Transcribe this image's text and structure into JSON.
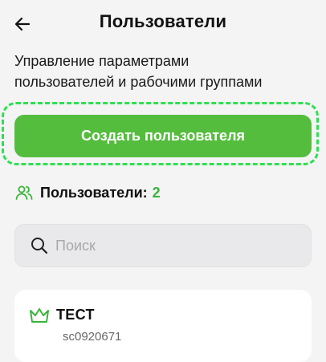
{
  "header": {
    "back_icon": "arrow-left-icon",
    "title": "Пользователи"
  },
  "description": {
    "line1": "Управление параметрами",
    "line2": "пользователей и рабочими группами"
  },
  "create_button": {
    "label": "Создать пользователя",
    "color": "#55bd3d",
    "highlight_color": "#2ee04f"
  },
  "users_summary": {
    "icon": "users-icon",
    "label": "Пользователи:",
    "count": "2",
    "count_color": "#38b53a"
  },
  "search": {
    "icon": "search-icon",
    "placeholder": "Поиск",
    "value": ""
  },
  "users": [
    {
      "icon": "crown-icon",
      "name": "ТЕСТ",
      "login": "sc0920671"
    }
  ]
}
